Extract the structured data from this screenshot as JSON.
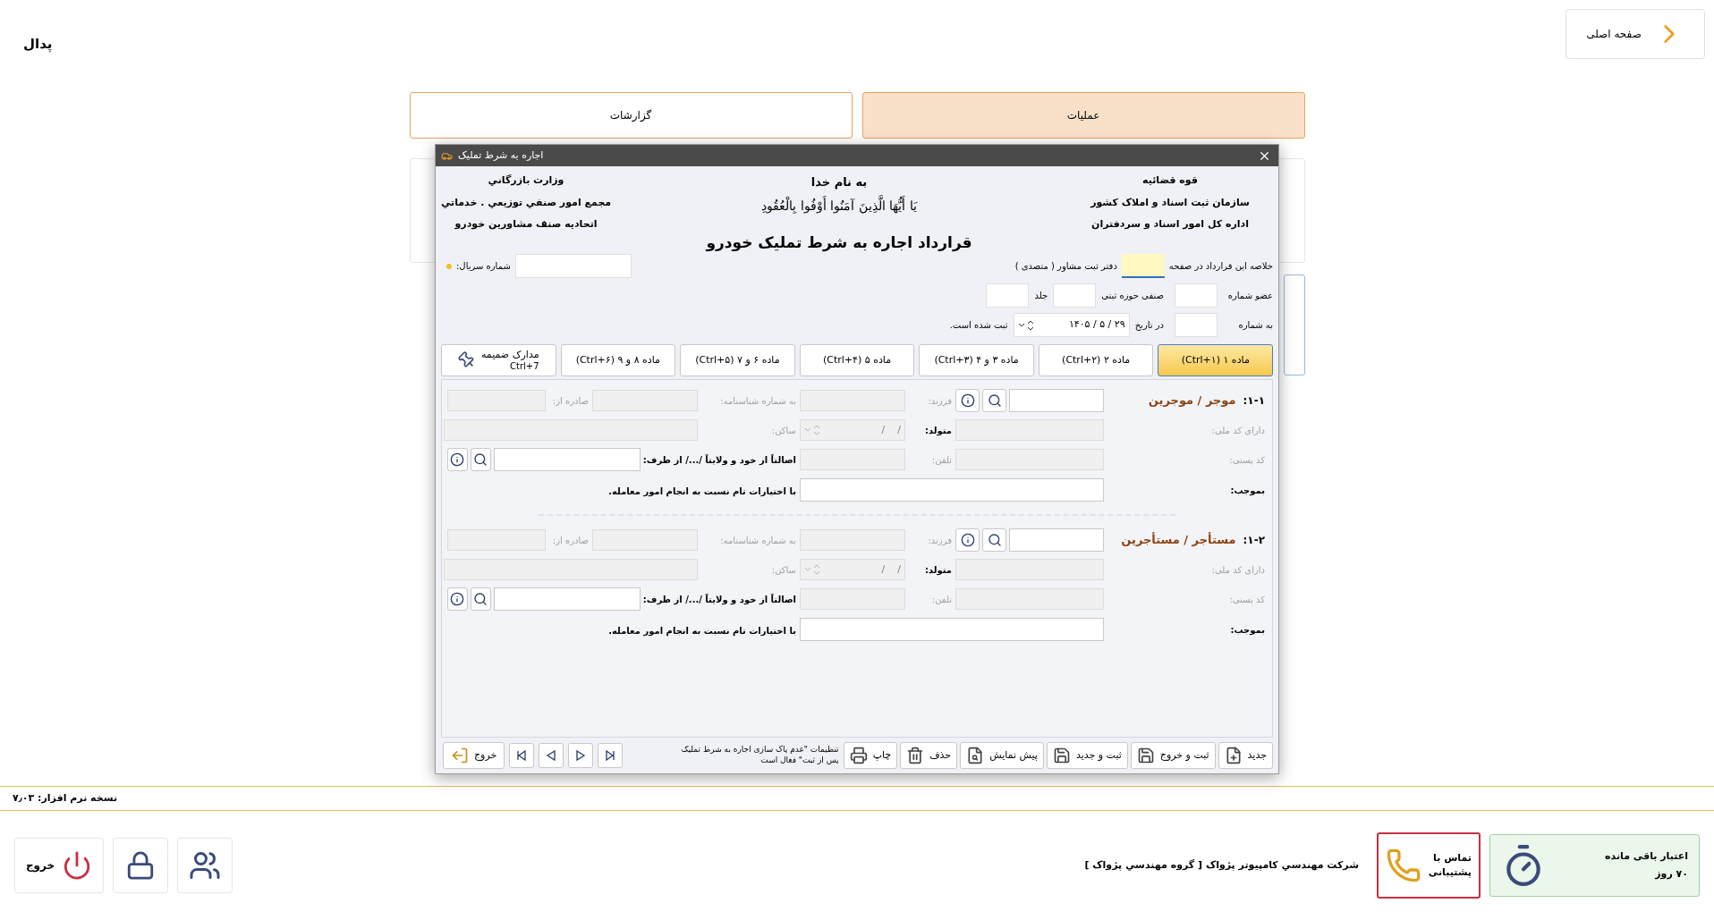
{
  "app": {
    "title": "پدال",
    "home_button": "صفحه اصلی"
  },
  "tabs": [
    {
      "label": "عملیات",
      "selected": true
    },
    {
      "label": "گزارشات",
      "selected": false
    }
  ],
  "dialog": {
    "title": "اجاره به شرط تملیک",
    "header_right": [
      "قوه قضائیه",
      "سازمان ثبت اسناد و املاک کشور",
      "اداره کل امور اسناد و سردفتران"
    ],
    "header_center": [
      "به نام خدا",
      "يَا أَيُّهَا الَّذِينَ آمَنُوا أَوْفُوا بِالْعُقُودِ"
    ],
    "header_left": [
      "وزارت بازرگاني",
      "مجمع امور صنفي توزيعي . خدماتي",
      "اتحاديه صنف مشاورين خودرو"
    ],
    "contract_title": "قرارداد اجاره به شرط تملیک خودرو",
    "serial_label": "شماره سریال:",
    "summary_label": "خلاصه این قرارداد در صفحه",
    "office_label": "دفتر ثبت مشاور ( متصدی )",
    "member_label": "عضو شماره",
    "zone_label": "صنفی حوزه ثبتی",
    "volume_label": "جلد",
    "number_label": "به شماره",
    "date_label": "در تاریخ",
    "date_value": "۱۴۰۵ / ۵ / ۲۹",
    "registered_label": "ثبت شده است.",
    "article_tabs": [
      {
        "label": "ماده ۱ (Ctrl+۱)",
        "selected": true
      },
      {
        "label": "ماده ۲  (Ctrl+۲)",
        "selected": false
      },
      {
        "label": "ماده ۳ و ۴ (Ctrl+۳)",
        "selected": false
      },
      {
        "label": "ماده ۵  (Ctrl+۴)",
        "selected": false
      },
      {
        "label": "ماده ۶ و ۷ (Ctrl+۵)",
        "selected": false
      },
      {
        "label": "ماده ۸ و ۹ (Ctrl+۶)",
        "selected": false
      },
      {
        "label": "مدارک ضمیمه",
        "shortcut": "Ctrl+7",
        "kind": "attachments",
        "selected": false
      }
    ],
    "parties": [
      {
        "number": "۱-۱:",
        "title": "موجر / موجرین",
        "child": {
          "label": "فرزند:",
          "disabled": true
        },
        "id_number": {
          "label": "به شماره شناسنامه:",
          "disabled": true
        },
        "issued": {
          "label": "صادره از:",
          "disabled": true
        },
        "national_code": {
          "label": "دارای کد ملی:",
          "disabled": true
        },
        "born": {
          "label": "متولد:",
          "value": "/    /",
          "disabled": true
        },
        "resident": {
          "label": "ساکن:",
          "disabled": true
        },
        "postal_code": {
          "label": "کد پستی:",
          "disabled": true
        },
        "phone": {
          "label": "تلفن:",
          "disabled": true
        },
        "on_behalf": {
          "label": "اصالتاً از خود و ولایتاً /.../ از طرف:",
          "disabled": false
        },
        "by_virtue": {
          "label": "بموجب:",
          "disabled": false
        },
        "authority_note": "با اختیارات تام نسبت به انجام امور معامله."
      },
      {
        "number": "۱-۲:",
        "title": "مستأجر / مستأجرین",
        "child": {
          "label": "فرزند:",
          "disabled": true
        },
        "id_number": {
          "label": "به شماره شناسنامه:",
          "disabled": true
        },
        "issued": {
          "label": "صادره از:",
          "disabled": true
        },
        "national_code": {
          "label": "دارای کد ملی:",
          "disabled": true
        },
        "born": {
          "label": "متولد:",
          "value": "/    /",
          "disabled": true
        },
        "resident": {
          "label": "ساکن:",
          "disabled": true
        },
        "postal_code": {
          "label": "کد پستی:",
          "disabled": true
        },
        "phone": {
          "label": "تلفن:",
          "disabled": true
        },
        "on_behalf": {
          "label": "اصالتاً از خود و ولایتاً /.../ از طرف:",
          "disabled": false
        },
        "by_virtue": {
          "label": "بموجب:",
          "disabled": false
        },
        "authority_note": "با اختیارات تام نسبت به انجام امور معامله."
      }
    ],
    "toolbar": [
      {
        "label": "جدید",
        "kind": "new"
      },
      {
        "label": "ثبت و خروج",
        "kind": "save_exit"
      },
      {
        "label": "ثبت و جدید",
        "kind": "save_new"
      },
      {
        "label": "پیش نمایش",
        "kind": "preview"
      },
      {
        "label": "حذف",
        "kind": "delete"
      },
      {
        "label": "چاپ",
        "kind": "print"
      }
    ],
    "settings_note": "تنظیمات \"عدم پاک سازی اجاره به شرط تملیک پس از ثبت\" فعال است",
    "exit_button": "خروج"
  },
  "status": {
    "version": "نسخه نرم افزار: ۷٫۰۳"
  },
  "footer": {
    "credit_label": "اعتبار باقی مانده",
    "credit_value": "۷۰ روز",
    "support_label": "تماس با پشتیبانی",
    "company": "شرکت مهندسي کامپيوتر پژواک [ گروه مهندسي پژواک ]",
    "exit": "خروج"
  }
}
